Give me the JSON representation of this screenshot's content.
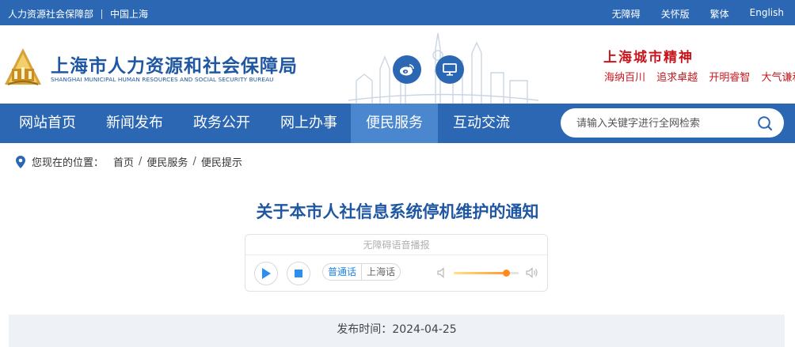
{
  "topbar": {
    "org": "人力资源社会保障部",
    "region": "中国上海",
    "links": [
      "无障碍",
      "关怀版",
      "繁体",
      "English"
    ]
  },
  "header": {
    "title": "上海市人力资源和社会保障局",
    "subtitle": "SHANGHAI MUNICIPAL HUMAN RESOURCES AND SOCIAL SECURITY BUREAU",
    "icons": [
      "weibo-icon",
      "monitor-icon"
    ],
    "spirit_title": "上海城市精神",
    "spirit_phrases": [
      "海纳百川",
      "追求卓越",
      "开明睿智",
      "大气谦和"
    ]
  },
  "nav": {
    "items": [
      "网站首页",
      "新闻发布",
      "政务公开",
      "网上办事",
      "便民服务",
      "互动交流"
    ],
    "active_index": 4,
    "search_placeholder": "请输入关键字进行全网检索"
  },
  "breadcrumb": {
    "label": "您现在的位置：",
    "items": [
      "首页",
      "便民服务",
      "便民提示"
    ]
  },
  "article": {
    "title": "关于本市人社信息系统停机维护的通知",
    "publish_label": "发布时间：",
    "publish_date": "2024-04-25"
  },
  "player": {
    "caption": "无障碍语音播报",
    "languages": [
      "普通话",
      "上海话"
    ],
    "selected_language": "普通话",
    "volume": 0.8
  },
  "colors": {
    "primary": "#2c67b3",
    "nav_active": "#4a87cf",
    "title_blue": "#1f57a3",
    "spirit_red": "#c8161d",
    "accent_orange": "#ff8a1f"
  }
}
